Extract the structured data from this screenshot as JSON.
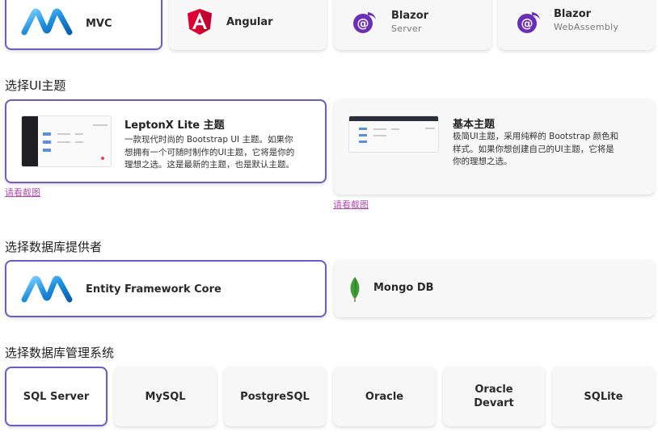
{
  "frameworks": [
    {
      "label": "MVC",
      "sub": "",
      "icon": "dotnet-logo-icon",
      "selected": true
    },
    {
      "label": "Angular",
      "sub": "",
      "icon": "angular-logo-icon",
      "selected": false
    },
    {
      "label": "Blazor",
      "sub": "Server",
      "icon": "blazor-logo-icon",
      "selected": false
    },
    {
      "label": "Blazor",
      "sub": "WebAssembly",
      "icon": "blazor-logo-icon",
      "selected": false
    }
  ],
  "ui_theme": {
    "heading": "选择UI主题",
    "options": [
      {
        "title": "LeptonX Lite 主题",
        "desc_lines": [
          "一款现代时尚的 Bootstrap UI 主题。如果你",
          "想拥有一个可随时制作的UI主题，它将是你的",
          "理想之选。这是最新的主题，也是默认主题。"
        ],
        "link": "请看截图",
        "selected": true
      },
      {
        "title": "基本主题",
        "desc_lines": [
          "极简UI主题，采用纯粹的 Bootstrap 颜色和",
          "样式。如果你想创建自己的UI主题，它将是",
          "你的理想之选。"
        ],
        "link": "请看截图",
        "selected": false
      }
    ]
  },
  "db_provider": {
    "heading": "选择数据库提供者",
    "options": [
      {
        "label": "Entity Framework Core",
        "icon": "dotnet-logo-icon",
        "selected": true
      },
      {
        "label": "Mongo DB",
        "icon": "mongodb-leaf-icon",
        "selected": false
      }
    ]
  },
  "dbms": {
    "heading": "选择数据库管理系统",
    "options": [
      {
        "label": "SQL Server",
        "selected": true
      },
      {
        "label": "MySQL",
        "selected": false
      },
      {
        "label": "PostgreSQL",
        "selected": false
      },
      {
        "label": "Oracle",
        "selected": false
      },
      {
        "label": "Oracle\nDevart",
        "selected": false
      },
      {
        "label": "SQLite",
        "selected": false
      }
    ]
  },
  "colors": {
    "accent": "#6f5bc6",
    "link": "#b04fa8",
    "angular": "#dd0031",
    "blazor": "#6a2fb5",
    "dotnet": "#1e90e0",
    "mongo": "#3f9b35"
  }
}
